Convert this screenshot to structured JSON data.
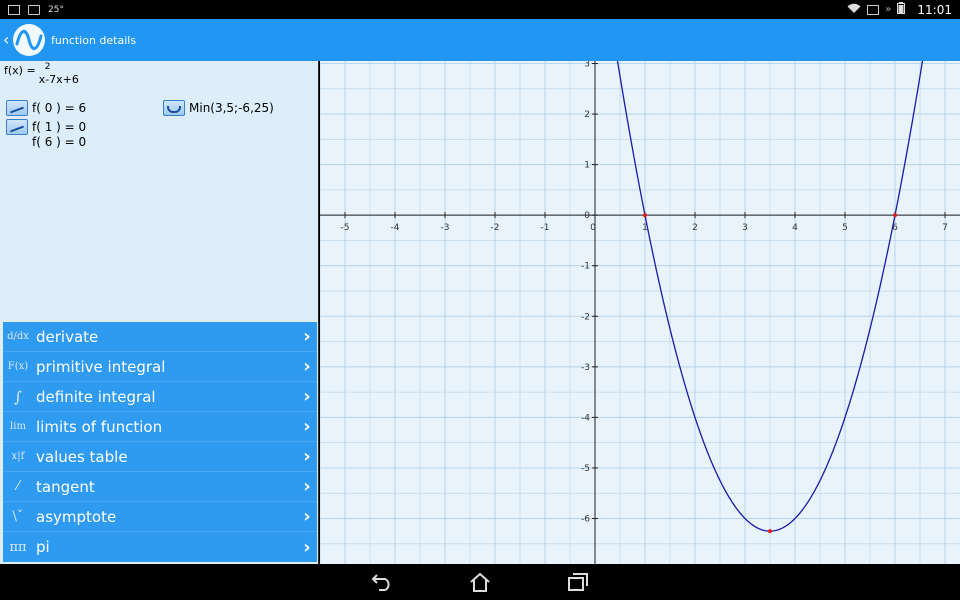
{
  "status_bar": {
    "temperature": "25°",
    "time": "11:01"
  },
  "action_bar": {
    "title": "function details",
    "back": "‹"
  },
  "function": {
    "label": "f(x) =",
    "expr_main": "x",
    "expr_exp": "2",
    "expr_rest": "-7x+6"
  },
  "info": {
    "f0": "f( 0 ) = 6",
    "min": "Min(3,5;-6,25)",
    "root1": "f( 1 ) = 0",
    "root2": "f( 6 ) = 0"
  },
  "menu": [
    {
      "label": "derivate",
      "icon": "d/dx"
    },
    {
      "label": "primitive integral",
      "icon": "F(x)"
    },
    {
      "label": "definite integral",
      "icon": "∫ab"
    },
    {
      "label": "limits of function",
      "icon": "lim"
    },
    {
      "label": "values table",
      "icon": "x|f(x)"
    },
    {
      "label": "tangent",
      "icon": "tangent"
    },
    {
      "label": "asymptote",
      "icon": "asymptote"
    },
    {
      "label": "pi",
      "icon": "ππ"
    }
  ],
  "chart_data": {
    "type": "line",
    "function": "x^2-7x+6",
    "xlim": [
      -5.5,
      7.3
    ],
    "ylim": [
      -6.9,
      3.05
    ],
    "x_ticks": [
      -5,
      -4,
      -3,
      -2,
      -1,
      0,
      1,
      2,
      3,
      4,
      5,
      6,
      7
    ],
    "y_ticks": [
      3,
      2,
      1,
      0,
      -1,
      -2,
      -3,
      -4,
      -5,
      -6
    ],
    "grid": true,
    "line_color": "#1a1aa8",
    "points": [
      {
        "x": 1,
        "y": 0
      },
      {
        "x": 6,
        "y": 0
      },
      {
        "x": 3.5,
        "y": -6.25
      }
    ],
    "point_color": "#e02020"
  },
  "colors": {
    "action_bar": "#2196f3",
    "menu_bg": "#2e9af0",
    "panel_bg": "#ddeefa",
    "graph_bg": "#e8f3fb"
  }
}
